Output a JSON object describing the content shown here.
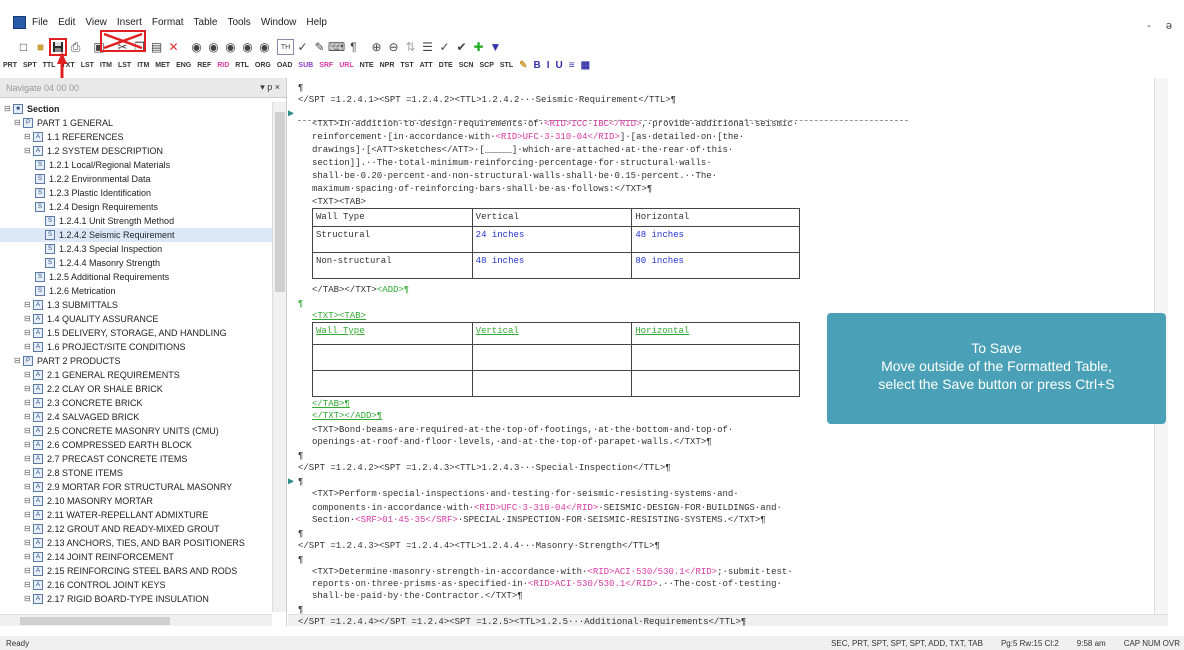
{
  "menubar": {
    "items": [
      "File",
      "Edit",
      "View",
      "Insert",
      "Format",
      "Table",
      "Tools",
      "Window",
      "Help"
    ],
    "window_controls": "- ə"
  },
  "toolbar2": {
    "items": [
      "PRT",
      "SPT",
      "TTL",
      "TXT",
      "LST",
      "ITM",
      "LST",
      "ITM",
      "MET",
      "ENG",
      "REF",
      "RID",
      "RTL",
      "ORG",
      "OAD",
      "SUB",
      "SRF",
      "URL",
      "NTE",
      "NPR",
      "TST",
      "ATT",
      "DTE",
      "SCN",
      "SCP",
      "STL"
    ]
  },
  "nav": {
    "title": "Navigate 04 00 00",
    "controls": "▾ p ×",
    "tree": [
      {
        "level": 0,
        "label": "Section",
        "bold": true
      },
      {
        "level": 1,
        "label": "PART 1  GENERAL"
      },
      {
        "level": 2,
        "label": "1.1  REFERENCES"
      },
      {
        "level": 2,
        "label": "1.2  SYSTEM DESCRIPTION"
      },
      {
        "level": 3,
        "label": "1.2.1  Local/Regional Materials"
      },
      {
        "level": 3,
        "label": "1.2.2  Environmental Data"
      },
      {
        "level": 3,
        "label": "1.2.3  Plastic Identification"
      },
      {
        "level": 3,
        "label": "1.2.4  Design Requirements"
      },
      {
        "level": 4,
        "label": "1.2.4.1  Unit Strength Method"
      },
      {
        "level": 4,
        "label": "1.2.4.2  Seismic Requirement",
        "selected": true
      },
      {
        "level": 4,
        "label": "1.2.4.3  Special Inspection"
      },
      {
        "level": 4,
        "label": "1.2.4.4  Masonry Strength"
      },
      {
        "level": 3,
        "label": "1.2.5  Additional Requirements"
      },
      {
        "level": 3,
        "label": "1.2.6  Metrication"
      },
      {
        "level": 2,
        "label": "1.3  SUBMITTALS"
      },
      {
        "level": 2,
        "label": "1.4  QUALITY ASSURANCE"
      },
      {
        "level": 2,
        "label": "1.5  DELIVERY, STORAGE, AND HANDLING"
      },
      {
        "level": 2,
        "label": "1.6  PROJECT/SITE CONDITIONS"
      },
      {
        "level": 1,
        "label": "PART 2  PRODUCTS"
      },
      {
        "level": 2,
        "label": "2.1  GENERAL REQUIREMENTS"
      },
      {
        "level": 2,
        "label": "2.2  CLAY OR SHALE BRICK"
      },
      {
        "level": 2,
        "label": "2.3  CONCRETE BRICK"
      },
      {
        "level": 2,
        "label": "2.4  SALVAGED BRICK"
      },
      {
        "level": 2,
        "label": "2.5  CONCRETE MASONRY UNITS (CMU)"
      },
      {
        "level": 2,
        "label": "2.6  COMPRESSED EARTH BLOCK"
      },
      {
        "level": 2,
        "label": "2.7  PRECAST CONCRETE ITEMS"
      },
      {
        "level": 2,
        "label": "2.8  STONE ITEMS"
      },
      {
        "level": 2,
        "label": "2.9  MORTAR FOR STRUCTURAL MASONRY"
      },
      {
        "level": 2,
        "label": "2.10  MASONRY MORTAR"
      },
      {
        "level": 2,
        "label": "2.11  WATER-REPELLANT ADMIXTURE"
      },
      {
        "level": 2,
        "label": "2.12  GROUT AND READY-MIXED GROUT"
      },
      {
        "level": 2,
        "label": "2.13  ANCHORS, TIES, AND BAR POSITIONERS"
      },
      {
        "level": 2,
        "label": "2.14  JOINT REINFORCEMENT"
      },
      {
        "level": 2,
        "label": "2.15  REINFORCING STEEL BARS AND RODS"
      },
      {
        "level": 2,
        "label": "2.16  CONTROL JOINT KEYS"
      },
      {
        "level": 2,
        "label": "2.17  RIGID BOARD-TYPE INSULATION"
      }
    ]
  },
  "editor": {
    "lines": [
      {
        "text": "¶"
      },
      {
        "text": "</SPT =1.2.4.1><SPT =1.2.4.2><TTL>1.2.4.2···Seismic·Requirement</TTL>¶"
      },
      {
        "text": "<TXT>In·addition·to·design·requirements·of·",
        "rid": "<RID>ICC·IBC</RID>",
        "after": ",·provide·additional·seismic·"
      },
      {
        "text": "reinforcement·[in·accordance·with·",
        "rid": "<RID>UFC·3-310-04</RID>",
        "after": "]·[as·detailed·on·[the·"
      },
      {
        "text": "drawings]·[<ATT>sketches</ATT>·[_____]·which·are·attached·at·the·rear·of·this·"
      },
      {
        "text": "section]].··The·total·minimum·reinforcing·percentage·for·structural·walls·"
      },
      {
        "text": "shall·be·0.20·percent·and·non-structural·walls·shall·be·0.15·percent.··The·"
      },
      {
        "text": "maximum·spacing·of·reinforcing·bars·shall·be·as·follows:</TXT>¶"
      },
      {
        "text": "<TXT><TAB>"
      }
    ],
    "table1": {
      "headers": [
        "Wall Type",
        "Vertical",
        "Horizontal"
      ],
      "rows": [
        [
          "Structural",
          "24 inches",
          "48 inches"
        ],
        [
          "Non-structural",
          "48 inches",
          "80 inches"
        ]
      ]
    },
    "after_table1": "</TAB></TXT>",
    "add_tag": "<ADD>¶",
    "para": "¶",
    "txt_tab": "<TXT><TAB>",
    "table2": {
      "headers": [
        "Wall Type",
        "Vertical",
        "Horizontal"
      ]
    },
    "tab_close": "</TAB>¶",
    "txt_add_close": "</TXT></ADD>¶",
    "lines2": [
      {
        "text": "<TXT>Bond·beams·are·required·at·the·top·of·footings,·at·the·bottom·and·top·of·"
      },
      {
        "text": "openings·at·roof·and·floor·levels,·and·at·the·top·of·parapet·walls.</TXT>¶"
      },
      {
        "text": "¶"
      },
      {
        "text": "</SPT =1.2.4.2><SPT =1.2.4.3><TTL>1.2.4.3···Special·Inspection</TTL>¶"
      },
      {
        "text": "¶"
      },
      {
        "text": "<TXT>Perform·special·inspections·and·testing·for·seismic-resisting·systems·and·"
      },
      {
        "text": "components·in·accordance·with·",
        "rid": "<RID>UFC·3-310-04</RID>",
        "after": "·SEISMIC·DESIGN·FOR·BUILDINGS·and·"
      },
      {
        "text": "Section·",
        "rid": "<SRF>01·45·35</SRF>",
        "after": "·SPECIAL·INSPECTION·FOR·SEISMIC-RESISTING·SYSTEMS.</TXT>¶"
      },
      {
        "text": "¶"
      },
      {
        "text": "</SPT =1.2.4.3><SPT =1.2.4.4><TTL>1.2.4.4···Masonry·Strength</TTL>¶"
      },
      {
        "text": "¶"
      },
      {
        "text": "<TXT>Determine·masonry·strength·in·accordance·with·",
        "rid": "<RID>ACI·530/530.1</RID>",
        "after": ";·submit·test·"
      },
      {
        "text": "reports·on·three·prisms·as·specified·in·",
        "rid": "<RID>ACI·530/530.1</RID>",
        "after": ".··The·cost·of·testing·"
      },
      {
        "text": "shall·be·paid·by·the·Contractor.</TXT>¶"
      },
      {
        "text": "¶"
      },
      {
        "text": "</SPT =1.2.4.4></SPT =1.2.4><SPT =1.2.5><TTL>1.2.5···Additional·Requirements</TTL>¶"
      }
    ]
  },
  "callout": {
    "line1": "To Save",
    "line2": "Move outside of the Formatted Table,",
    "line3": "select the Save button or press Ctrl+S"
  },
  "status": {
    "left": "Ready",
    "tags": "SEC, PRT, SPT, SPT, SPT, ADD, TXT, TAB",
    "position": "Pg:5 Rw:15 Cl:2",
    "time": "9:58 am",
    "modes": "CAP NUM OVR"
  },
  "colors": {
    "callout_bg": "#4aa0b6",
    "highlight_red": "#e02020",
    "rid_pink": "#d93aa5"
  }
}
